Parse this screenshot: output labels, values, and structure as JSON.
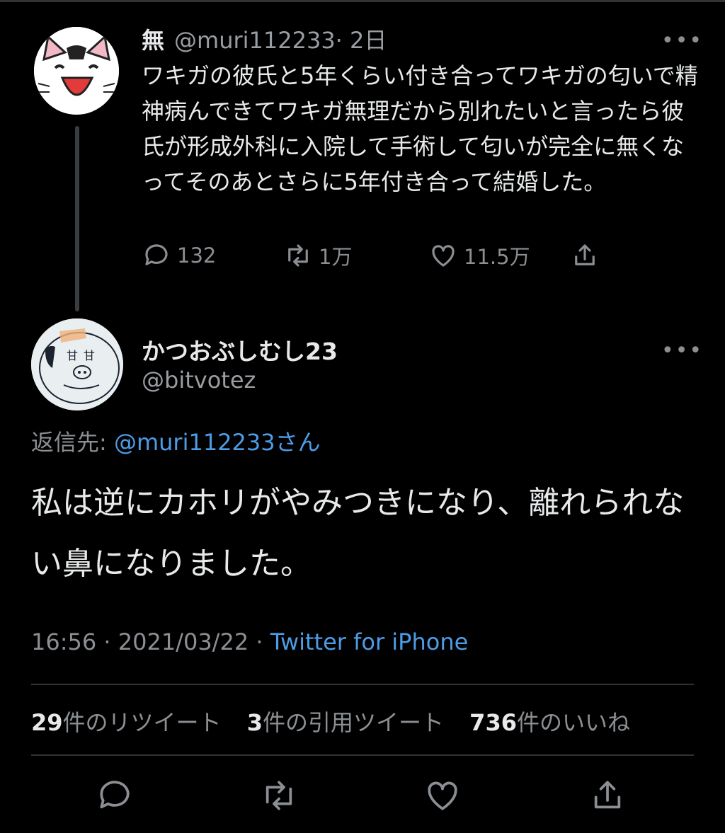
{
  "parent": {
    "name": "無",
    "handle": "@muri112233",
    "time": "· 2日",
    "more": "•••",
    "body": "ワキガの彼氏と5年くらい付き合ってワキガの匂いで精神病んできてワキガ無理だから別れたいと言ったら彼氏が形成外科に入院して手術して匂いが完全に無くなってそのあとさらに5年付き合って結婚した。",
    "replies": "132",
    "retweets": "1万",
    "likes": "11.5万"
  },
  "reply": {
    "name": "かつおぶしむし23",
    "handle": "@bitvotez",
    "more": "•••",
    "reply_label": "返信先:",
    "reply_target": "@muri112233さん",
    "body": "私は逆にカホリがやみつきになり、離れられない鼻になりました。",
    "time": "16:56",
    "date": "· 2021/03/22 ·",
    "source": "Twitter for iPhone",
    "retweets_count": "29",
    "retweets_label": "件のリツイート",
    "quotes_count": "3",
    "quotes_label": "件の引用ツイート",
    "likes_count": "736",
    "likes_label": "件のいいね"
  },
  "colors": {
    "background": "#000000",
    "link": "#4d9ce7",
    "muted": "#8b8f93",
    "text": "#e7e9ea"
  },
  "icons": [
    "reply-icon",
    "retweet-icon",
    "like-icon",
    "share-icon",
    "more-icon"
  ]
}
